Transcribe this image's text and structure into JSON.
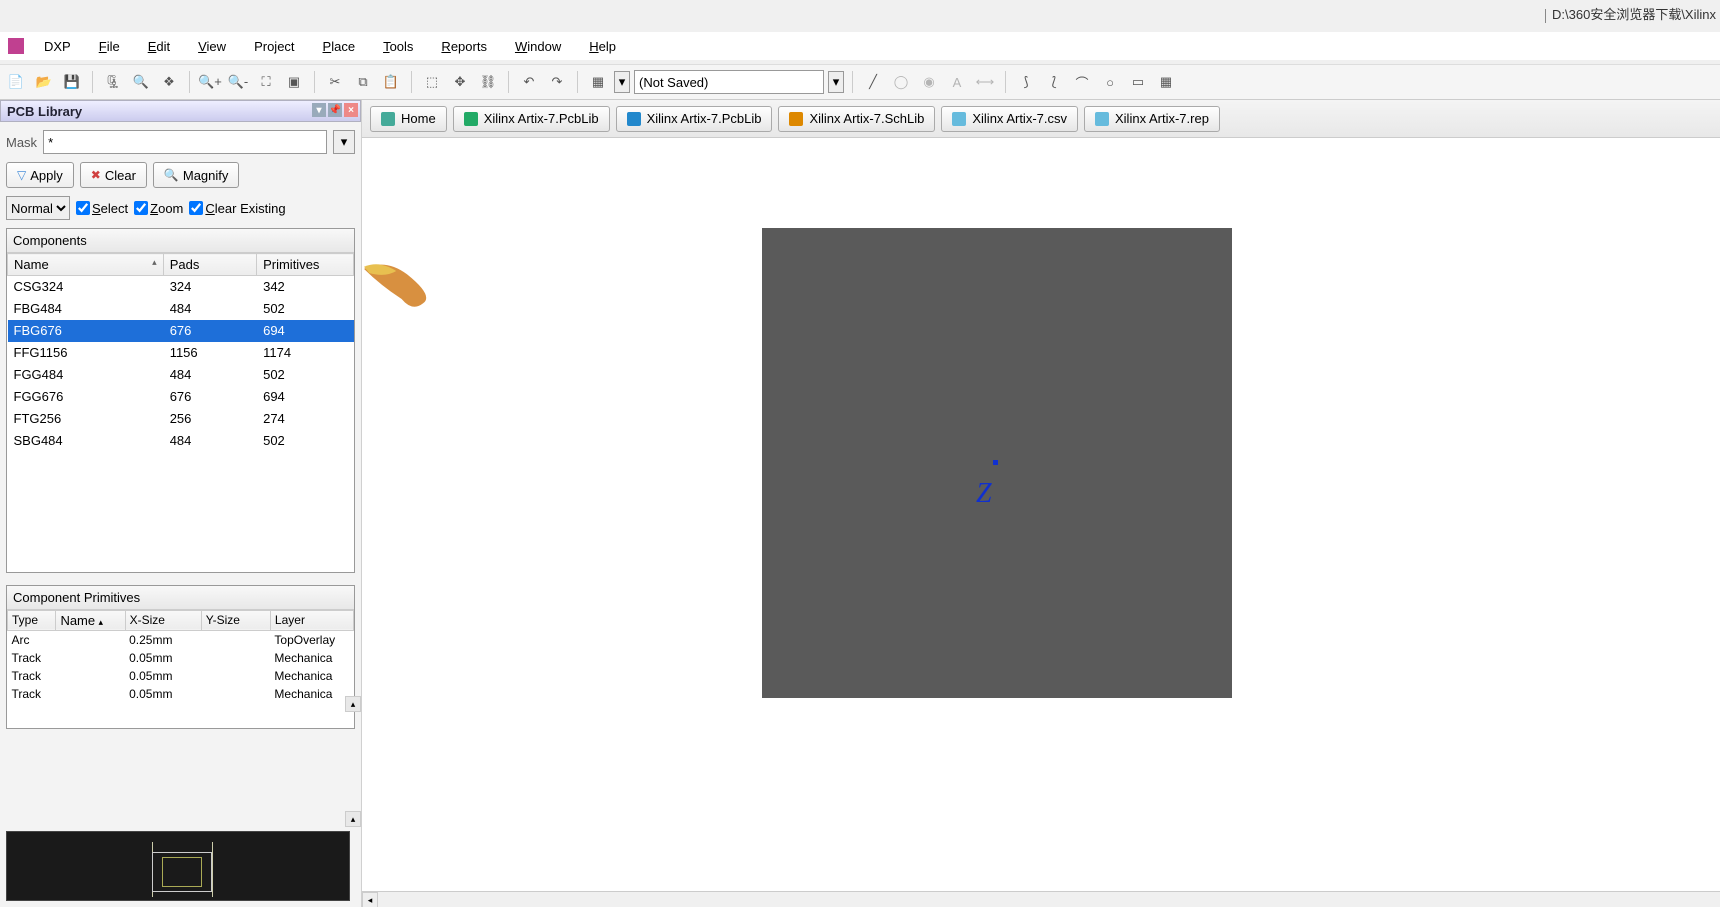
{
  "titlebar": {
    "path": "D:\\360安全浏览器下载\\Xilinx"
  },
  "menubar": {
    "dxp": "DXP",
    "items": [
      {
        "u": "F",
        "rest": "ile"
      },
      {
        "u": "E",
        "rest": "dit"
      },
      {
        "u": "V",
        "rest": "iew"
      },
      {
        "u": "P",
        "rest": "roject"
      },
      {
        "u": "P",
        "pre": "",
        "rest": "lace",
        "full": "Place",
        "uidx": 0
      },
      {
        "u": "T",
        "rest": "ools"
      },
      {
        "u": "R",
        "rest": "eports"
      },
      {
        "u": "W",
        "rest": "indow"
      },
      {
        "u": "H",
        "rest": "elp"
      }
    ],
    "labels": {
      "file": "File",
      "edit": "Edit",
      "view": "View",
      "project": "Project",
      "place": "Place",
      "tools": "Tools",
      "reports": "Reports",
      "window": "Window",
      "help": "Help"
    }
  },
  "toolbar": {
    "notSaved": "(Not Saved)"
  },
  "panel": {
    "title": "PCB Library",
    "maskLabel": "Mask",
    "maskValue": "*",
    "apply": "Apply",
    "clear": "Clear",
    "magnify": "Magnify",
    "mode": "Normal",
    "chkSelect": "Select",
    "chkZoom": "Zoom",
    "chkClear": "Clear Existing",
    "componentsHeader": "Components",
    "cols": {
      "name": "Name",
      "pads": "Pads",
      "prims": "Primitives"
    },
    "rows": [
      {
        "name": "CSG324",
        "pads": "324",
        "prims": "342",
        "sel": false
      },
      {
        "name": "FBG484",
        "pads": "484",
        "prims": "502",
        "sel": false
      },
      {
        "name": "FBG676",
        "pads": "676",
        "prims": "694",
        "sel": true
      },
      {
        "name": "FFG1156",
        "pads": "1156",
        "prims": "1174",
        "sel": false
      },
      {
        "name": "FGG484",
        "pads": "484",
        "prims": "502",
        "sel": false
      },
      {
        "name": "FGG676",
        "pads": "676",
        "prims": "694",
        "sel": false
      },
      {
        "name": "FTG256",
        "pads": "256",
        "prims": "274",
        "sel": false
      },
      {
        "name": "SBG484",
        "pads": "484",
        "prims": "502",
        "sel": false
      }
    ],
    "primHeader": "Component Primitives",
    "primCols": {
      "type": "Type",
      "name": "Name",
      "xsize": "X-Size",
      "ysize": "Y-Size",
      "layer": "Layer"
    },
    "primRows": [
      {
        "type": "Arc",
        "name": "",
        "x": "0.25mm",
        "y": "",
        "layer": "TopOverlay"
      },
      {
        "type": "Track",
        "name": "",
        "x": "0.05mm",
        "y": "",
        "layer": "Mechanica"
      },
      {
        "type": "Track",
        "name": "",
        "x": "0.05mm",
        "y": "",
        "layer": "Mechanica"
      },
      {
        "type": "Track",
        "name": "",
        "x": "0.05mm",
        "y": "",
        "layer": "Mechanica"
      }
    ]
  },
  "tabs": [
    {
      "label": "Home",
      "icon": "dic-home"
    },
    {
      "label": "Xilinx Artix-7.PcbLib",
      "icon": "dic-pcblib"
    },
    {
      "label": "Xilinx Artix-7.PcbLib",
      "icon": "dic-pcblib2"
    },
    {
      "label": "Xilinx Artix-7.SchLib",
      "icon": "dic-schlib"
    },
    {
      "label": "Xilinx Artix-7.csv",
      "icon": "dic-csv"
    },
    {
      "label": "Xilinx Artix-7.rep",
      "icon": "dic-rep"
    }
  ],
  "canvas": {
    "zLabel": "Z"
  }
}
